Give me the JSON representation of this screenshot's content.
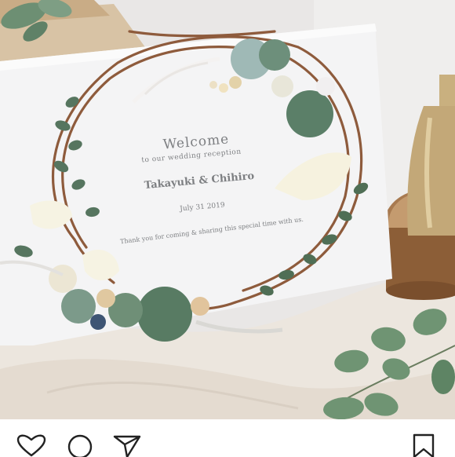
{
  "post": {
    "sign": {
      "welcome": "Welcome",
      "subtitle": "to our wedding reception",
      "names": "Takayuki & Chihiro",
      "date": "July 31 2019",
      "thanks": "Thank you for coming & sharing this special time with us."
    }
  },
  "action_bar": {
    "icons": [
      "heart-icon",
      "comment-icon",
      "send-icon",
      "bookmark-icon"
    ]
  },
  "colors": {
    "sign": "#f4f4f5",
    "wall": "#e9e7e6",
    "cloth": "#ece6de",
    "greenery": "#56755f",
    "gold": "#c3a878"
  }
}
